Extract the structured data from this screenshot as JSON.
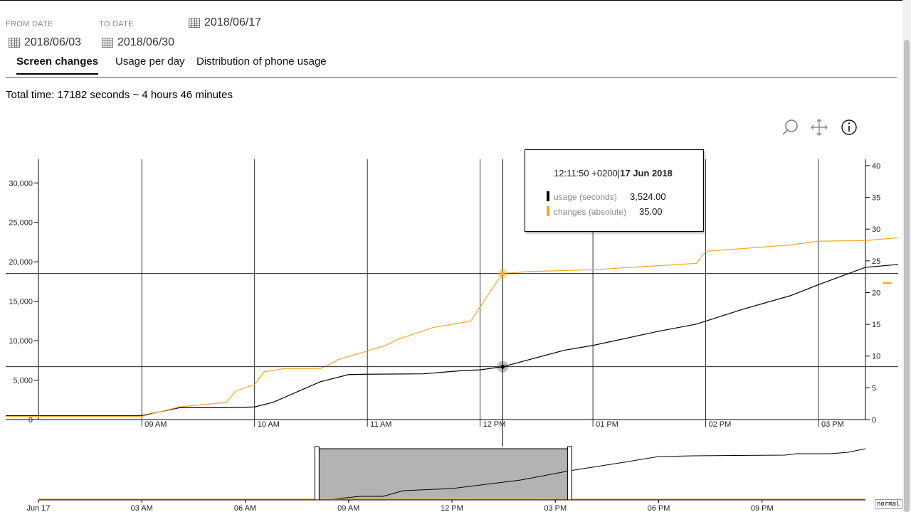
{
  "filters": {
    "from_label": "FROM DATE",
    "to_label": "TO DATE",
    "selected_date": "2018/06/17",
    "from_date": "2018/06/03",
    "to_date": "2018/06/30"
  },
  "tabs": [
    {
      "label": "Screen changes",
      "active": true
    },
    {
      "label": "Usage per day",
      "active": false
    },
    {
      "label": "Distribution of phone usage",
      "active": false
    }
  ],
  "summary": {
    "total_time": "Total time: 17182 seconds ~ 4 hours 46 minutes"
  },
  "toolbar": {
    "icons": [
      "zoom-icon",
      "pan-icon",
      "info-icon"
    ]
  },
  "tooltip": {
    "time": "12:11:50 +0200",
    "date": "17 Jun 2018",
    "rows": [
      {
        "label": "usage (seconds)",
        "value": "3,524.00",
        "color": "#000000"
      },
      {
        "label": "changes (absolute)",
        "value": "35.00",
        "color": "#f5a623"
      }
    ]
  },
  "navigator": {
    "mode_button": "normal"
  },
  "chart_data": {
    "type": "line",
    "x_unit": "time of day, 17 Jun 2018",
    "x_ticks": [
      "09 AM",
      "10 AM",
      "11 AM",
      "12 PM",
      "01 PM",
      "02 PM",
      "03 PM"
    ],
    "y_left": {
      "ticks": [
        "0",
        "5,000",
        "10,000",
        "15,000",
        "20,000",
        "25,000",
        "30,000"
      ],
      "ylim": [
        0,
        33000
      ]
    },
    "y_right": {
      "ticks": [
        "0",
        "5",
        "10",
        "15",
        "20",
        "25",
        "30",
        "35",
        "40"
      ],
      "ylim": [
        0,
        41
      ]
    },
    "xlim": [
      "08:05",
      "15:25"
    ],
    "crosshair": {
      "x": "12:12",
      "y_usage": 6700,
      "y_changes": 23
    },
    "series": [
      {
        "name": "usage (seconds)",
        "axis": "left",
        "color": "#000000",
        "points": [
          [
            "08:05",
            500
          ],
          [
            "09:00",
            500
          ],
          [
            "09:20",
            1500
          ],
          [
            "09:45",
            1500
          ],
          [
            "10:00",
            1600
          ],
          [
            "10:10",
            2200
          ],
          [
            "10:35",
            4800
          ],
          [
            "10:50",
            5700
          ],
          [
            "11:00",
            5750
          ],
          [
            "11:30",
            5800
          ],
          [
            "11:50",
            6200
          ],
          [
            "12:00",
            6300
          ],
          [
            "12:12",
            6700
          ],
          [
            "12:45",
            8800
          ],
          [
            "13:00",
            9400
          ],
          [
            "13:35",
            11200
          ],
          [
            "13:55",
            12100
          ],
          [
            "14:20",
            14000
          ],
          [
            "14:45",
            15700
          ],
          [
            "15:00",
            17100
          ],
          [
            "15:25",
            19300
          ]
        ]
      },
      {
        "name": "changes (absolute)",
        "axis": "right",
        "color": "#f5a623",
        "points": [
          [
            "08:05",
            0.5
          ],
          [
            "09:00",
            0.5
          ],
          [
            "09:20",
            2
          ],
          [
            "09:45",
            2.7
          ],
          [
            "09:50",
            4.5
          ],
          [
            "10:00",
            5.5
          ],
          [
            "10:05",
            7.5
          ],
          [
            "10:15",
            8
          ],
          [
            "10:35",
            8
          ],
          [
            "10:45",
            9.5
          ],
          [
            "11:00",
            10.8
          ],
          [
            "11:10",
            11.7
          ],
          [
            "11:15",
            12.5
          ],
          [
            "11:25",
            13.5
          ],
          [
            "11:35",
            14.5
          ],
          [
            "11:55",
            15.5
          ],
          [
            "12:05",
            20
          ],
          [
            "12:12",
            23
          ],
          [
            "12:25",
            23.3
          ],
          [
            "13:00",
            23.6
          ],
          [
            "13:55",
            24.6
          ],
          [
            "14:00",
            26.5
          ],
          [
            "14:45",
            27.5
          ],
          [
            "15:00",
            28.1
          ],
          [
            "15:25",
            28.2
          ]
        ]
      }
    ],
    "navigator": {
      "x_ticks": [
        "Jun 17",
        "03 AM",
        "06 AM",
        "09 AM",
        "12 PM",
        "03 PM",
        "06 PM",
        "09 PM"
      ],
      "selection": [
        "08:05",
        "15:25"
      ]
    }
  }
}
